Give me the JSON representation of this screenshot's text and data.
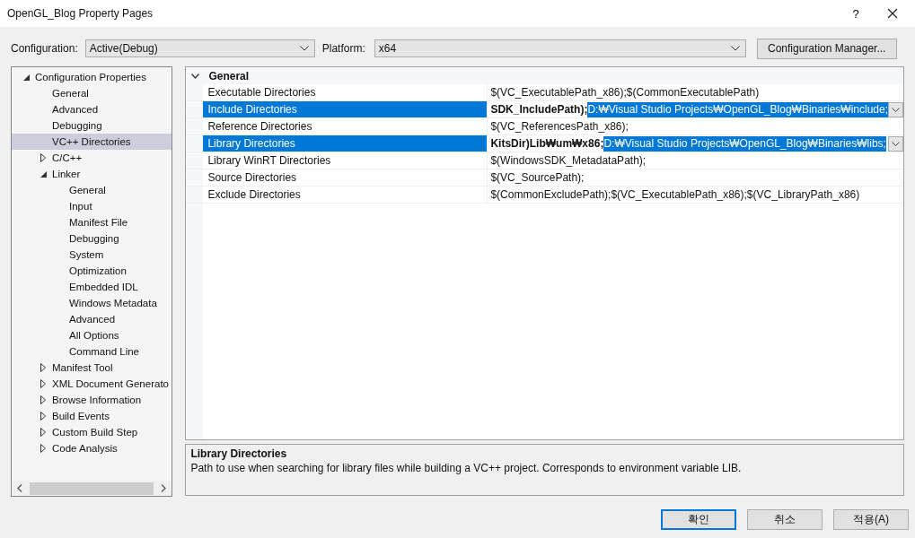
{
  "window": {
    "title": "OpenGL_Blog Property Pages",
    "help": "?"
  },
  "config_bar": {
    "configuration_label": "Configuration:",
    "configuration": "Active(Debug)",
    "platform_label": "Platform:",
    "platform": "x64",
    "manager_button": "Configuration Manager..."
  },
  "tree": [
    {
      "label": "Configuration Properties",
      "expanded": true,
      "selected": false,
      "children": [
        {
          "label": "General",
          "selected": false
        },
        {
          "label": "Advanced",
          "selected": false
        },
        {
          "label": "Debugging",
          "selected": false
        },
        {
          "label": "VC++ Directories",
          "selected": true
        },
        {
          "label": "C/C++",
          "expanded": false,
          "selected": false
        },
        {
          "label": "Linker",
          "expanded": true,
          "selected": false,
          "children": [
            {
              "label": "General",
              "selected": false
            },
            {
              "label": "Input",
              "selected": false
            },
            {
              "label": "Manifest File",
              "selected": false
            },
            {
              "label": "Debugging",
              "selected": false
            },
            {
              "label": "System",
              "selected": false
            },
            {
              "label": "Optimization",
              "selected": false
            },
            {
              "label": "Embedded IDL",
              "selected": false
            },
            {
              "label": "Windows Metadata",
              "selected": false
            },
            {
              "label": "Advanced",
              "selected": false
            },
            {
              "label": "All Options",
              "selected": false
            },
            {
              "label": "Command Line",
              "selected": false
            }
          ]
        },
        {
          "label": "Manifest Tool",
          "expanded": false,
          "selected": false
        },
        {
          "label": "XML Document Generato",
          "expanded": false,
          "selected": false
        },
        {
          "label": "Browse Information",
          "expanded": false,
          "selected": false
        },
        {
          "label": "Build Events",
          "expanded": false,
          "selected": false
        },
        {
          "label": "Custom Build Step",
          "expanded": false,
          "selected": false
        },
        {
          "label": "Code Analysis",
          "expanded": false,
          "selected": false
        }
      ]
    }
  ],
  "grid": {
    "category": "General",
    "expanded": true,
    "rows": [
      {
        "name": "Executable Directories",
        "value": "$(VC_ExecutablePath_x86);$(CommonExecutablePath)",
        "selected": false
      },
      {
        "name": "Include Directories",
        "value": "SDK_IncludePath);",
        "highlight": "D:₩Visual Studio Projects₩OpenGL_Blog₩Binaries₩include;",
        "selected": true
      },
      {
        "name": "Reference Directories",
        "value": "$(VC_ReferencesPath_x86);",
        "selected": false
      },
      {
        "name": "Library Directories",
        "value": "KitsDir)Lib₩um₩x86;",
        "highlight": "D:₩Visual Studio Projects₩OpenGL_Blog₩Binaries₩libs;",
        "selected": true
      },
      {
        "name": "Library WinRT Directories",
        "value": "$(WindowsSDK_MetadataPath);",
        "selected": false
      },
      {
        "name": "Source Directories",
        "value": "$(VC_SourcePath);",
        "selected": false
      },
      {
        "name": "Exclude Directories",
        "value": "$(CommonExcludePath);$(VC_ExecutablePath_x86);$(VC_LibraryPath_x86)",
        "selected": false
      }
    ]
  },
  "description": {
    "title": "Library Directories",
    "text": "Path to use when searching for library files while building a VC++ project.  Corresponds to environment variable LIB."
  },
  "buttons": [
    {
      "label": "확인",
      "default": true
    },
    {
      "label": "취소",
      "default": false
    },
    {
      "label": "적용(A)",
      "default": false
    }
  ]
}
